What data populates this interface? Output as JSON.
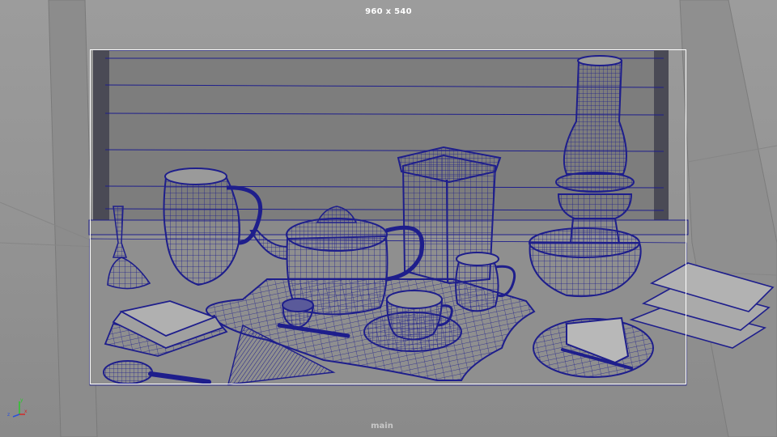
{
  "viewport": {
    "resolution_label": "960 x 540",
    "camera_label": "main",
    "wire_color": "#1e1e8c",
    "background_color": "#9c9c9c",
    "gate_color": "#ffffff"
  },
  "axis_gizmo": {
    "x_label": "x",
    "y_label": "y",
    "z_label": "z",
    "x_color": "#d22828",
    "y_color": "#28c828",
    "z_color": "#2850dc"
  }
}
